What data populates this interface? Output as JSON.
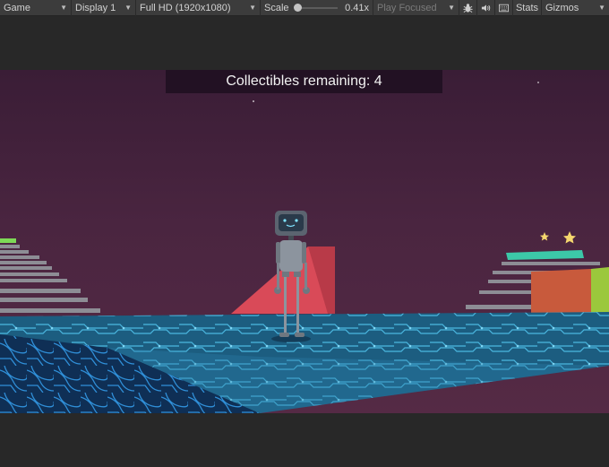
{
  "toolbar": {
    "view_label": "Game",
    "display_label": "Display 1",
    "resolution_label": "Full HD (1920x1080)",
    "scale_label": "Scale",
    "scale_value": "0.41x",
    "scale_fraction": 0.0,
    "play_mode_label": "Play Focused",
    "stats_label": "Stats",
    "gizmos_label": "Gizmos",
    "icons": [
      "caret-down-icon",
      "bug-icon",
      "speaker-icon",
      "keyboard-icon"
    ]
  },
  "game": {
    "hud_text": "Collectibles remaining: 4"
  },
  "colors": {
    "toolbar_bg": "#3c3c3c",
    "editor_bg": "#282828",
    "sky": "#4a2540",
    "floor_cyan": "#2d8fb3",
    "ramp_red": "#d94a58",
    "platform_teal": "#3cc8a8",
    "star_yellow": "#f5d76e"
  }
}
